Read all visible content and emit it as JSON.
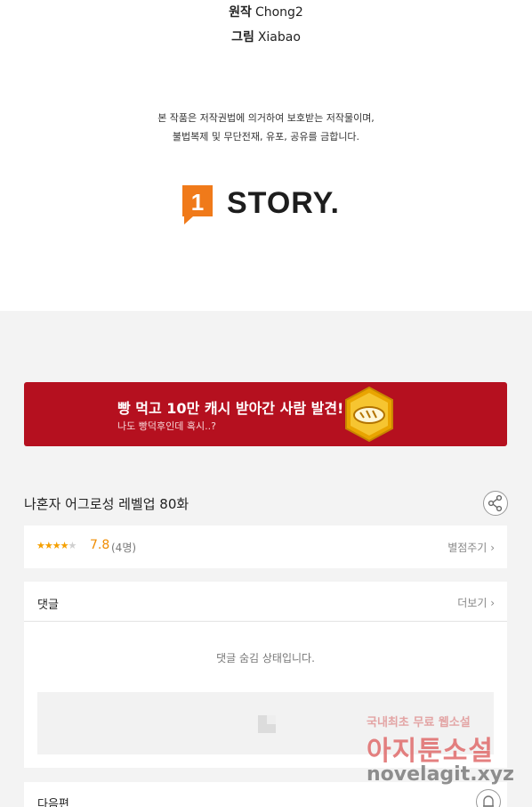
{
  "credits": {
    "original_label": "원작",
    "original_value": "Chong2",
    "art_label": "그림",
    "art_value": "Xiabao"
  },
  "copyright": {
    "line1": "본 작품은 저작권법에 의거하여 보호받는 저작물이며,",
    "line2": "불법복제 및 무단전재, 유포, 공유를 금합니다."
  },
  "logo": {
    "text": "STORY.",
    "mark_digit": "1",
    "color": "#f07a1a"
  },
  "banner": {
    "title": "빵 먹고 10만 캐시 받아간 사람 발견!",
    "subtitle": "나도 빵덕후인데 혹시..?",
    "background": "#b5101f",
    "badge_icon": "bread-badge-icon"
  },
  "episode": {
    "title": "나혼자 어그로성 레벨업 80화",
    "share_icon": "share-icon"
  },
  "rating": {
    "stars_filled": 4,
    "stars_total": 5,
    "score": "7.8",
    "count": "(4명)",
    "rate_link": "별점주기"
  },
  "comments": {
    "title": "댓글",
    "more_link": "더보기",
    "hidden_message": "댓글 숨김 상태입니다.",
    "input_icon": "image-icon"
  },
  "next": {
    "title": "다음편",
    "bell_icon": "bell-icon"
  },
  "watermark": {
    "line1": "국내최초 무료 웹소설",
    "line2": "아지툰소설",
    "line3": "novelagit.xyz"
  }
}
